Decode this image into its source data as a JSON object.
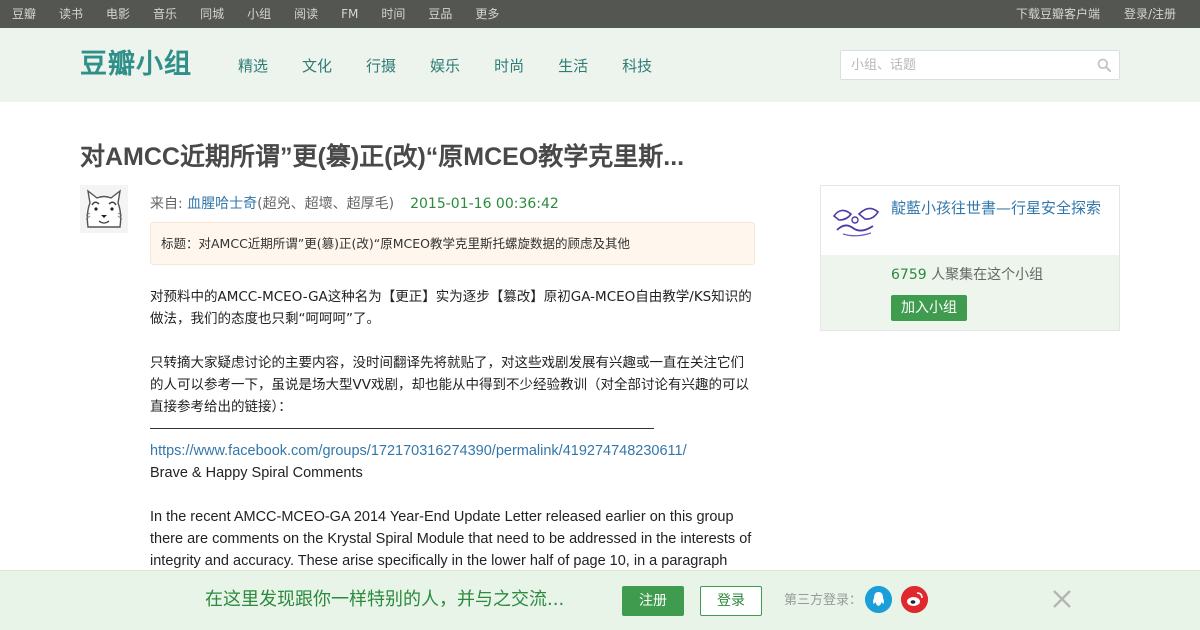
{
  "topbar": {
    "nav": [
      "豆瓣",
      "读书",
      "电影",
      "音乐",
      "同城",
      "小组",
      "阅读",
      "FM",
      "时间",
      "豆品",
      "更多"
    ],
    "download": "下载豆瓣客户端",
    "login": "登录/注册"
  },
  "header": {
    "logo": "豆瓣小组",
    "nav": [
      "精选",
      "文化",
      "行摄",
      "娱乐",
      "时尚",
      "生活",
      "科技"
    ],
    "search_placeholder": "小组、话题"
  },
  "post": {
    "title": "对AMCC近期所谓”更(篡)正(改)“原MCEO教学克里斯...",
    "from_label": "来自: ",
    "author": "血腥哈士奇",
    "author_note": "(超兇、超壞、超厚毛)",
    "date": "2015-01-16 00:36:42",
    "topic": "标题：对AMCC近期所谓”更(篡)正(改)“原MCEO教学克里斯托螺旋数据的顾虑及其他",
    "para1": "对预料中的AMCC-MCEO-GA这种名为【更正】实为逐步【篡改】原初GA-MCEO自由教学/KS知识的做法，我们的态度也只剩“呵呵呵”了。",
    "para2": "只转摘大家疑虑讨论的主要内容，没时间翻译先将就贴了，对这些戏剧发展有兴趣或一直在关注它们的人可以参考一下，虽说是场大型VV戏剧，却也能从中得到不少经验教训（对全部讨论有兴趣的可以直接参考给出的链接）：",
    "link": "https://www.facebook.com/groups/172170316274390/permalink/419274748230611/",
    "subtitle": "Brave & Happy Spiral Comments",
    "para3": "In the recent AMCC-MCEO-GA 2014 Year-End Update Letter released earlier on this group there are comments on the Krystal Spiral Module that need to be addressed in the interests of integrity and accuracy. These arise specifically in the lower half of page 10, in a paragraph"
  },
  "group": {
    "name": "靛藍小孩往世書—行星安全探索",
    "count": "6759",
    "count_suffix": " 人聚集在这个小组",
    "join": "加入小组"
  },
  "bottombar": {
    "slogan": "在这里发现跟你一样特别的人，并与之交流...",
    "register": "注册",
    "login": "登录",
    "third_party": "第三方登录："
  },
  "colors": {
    "brand_green": "#3f9c4e",
    "link_blue": "#3377aa",
    "logo_teal": "#2f8f89"
  },
  "icons": [
    "search-icon",
    "qq-icon",
    "weibo-icon",
    "close-icon"
  ]
}
